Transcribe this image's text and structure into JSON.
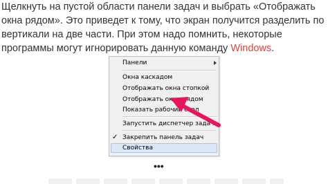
{
  "article": {
    "text_before": "Щелкнуть на пустой области панели задач и выбрать «Отображать окна рядом». Это приведет к тому, что экран получится разделить по вертикали на две части. При этом надо помнить, некоторые программы могут игнорировать данную команду ",
    "link_text": "Windows",
    "text_after": "."
  },
  "context_menu": {
    "items": [
      {
        "label": "Панели",
        "submenu": true
      },
      {
        "label": "Окна каскадом"
      },
      {
        "label": "Отображать окна стопкой"
      },
      {
        "label": "Отображать окна рядом"
      },
      {
        "label": "Показать рабочий стол"
      },
      {
        "label": "Запустить диспетчер задач"
      },
      {
        "label": "Закрепить панель задач",
        "checked": true
      },
      {
        "label": "Свойства",
        "highlighted": true
      }
    ],
    "check_mark": "✓"
  },
  "ellipsis": "•••",
  "colors": {
    "link": "#d9453a",
    "arrow": "#e8155e",
    "highlight": "#dde8f6"
  }
}
